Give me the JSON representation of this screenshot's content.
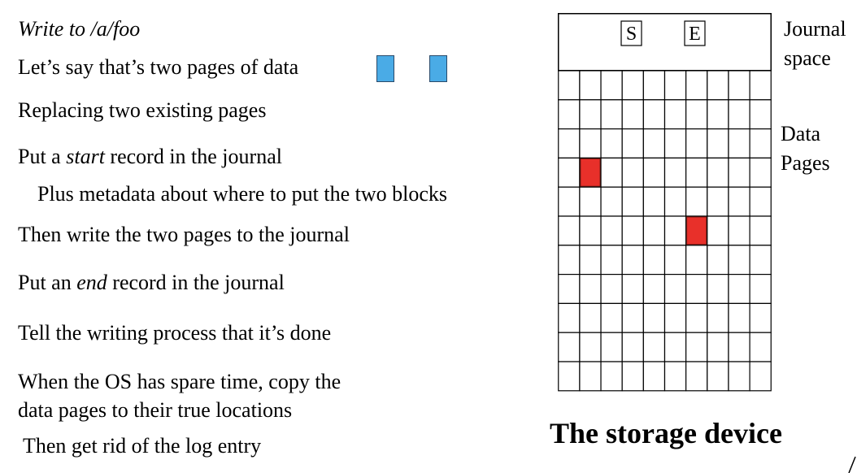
{
  "steps": {
    "write": "Write to /a/foo",
    "two_pages": "Let’s say that’s two pages of data",
    "replacing": "Replacing two existing pages",
    "start_pre": "Put a ",
    "start_em": "start",
    "start_post": " record in the journal",
    "metadata": "Plus metadata about where to put the two blocks",
    "write_pages": "Then write the two pages to the journal",
    "end_pre": "Put an ",
    "end_em": "end",
    "end_post": " record in the journal",
    "tell": "Tell the writing process that it’s done",
    "spare_1": "When the OS has spare time, copy the",
    "spare_2": "data pages to their true locations",
    "rid": "Then get rid of the log entry"
  },
  "storage": {
    "journal_label_1": "Journal",
    "journal_label_2": "space",
    "data_label_1": "Data",
    "data_label_2": "Pages",
    "start_marker": "S",
    "end_marker": "E",
    "title": "The storage device",
    "grid_cols": 10,
    "grid_rows": 11,
    "marked_cells": [
      {
        "row": 3,
        "col": 1
      },
      {
        "row": 5,
        "col": 6
      }
    ]
  },
  "colors": {
    "page_blue": "#4aabe6",
    "marked_red": "#e8302a"
  }
}
